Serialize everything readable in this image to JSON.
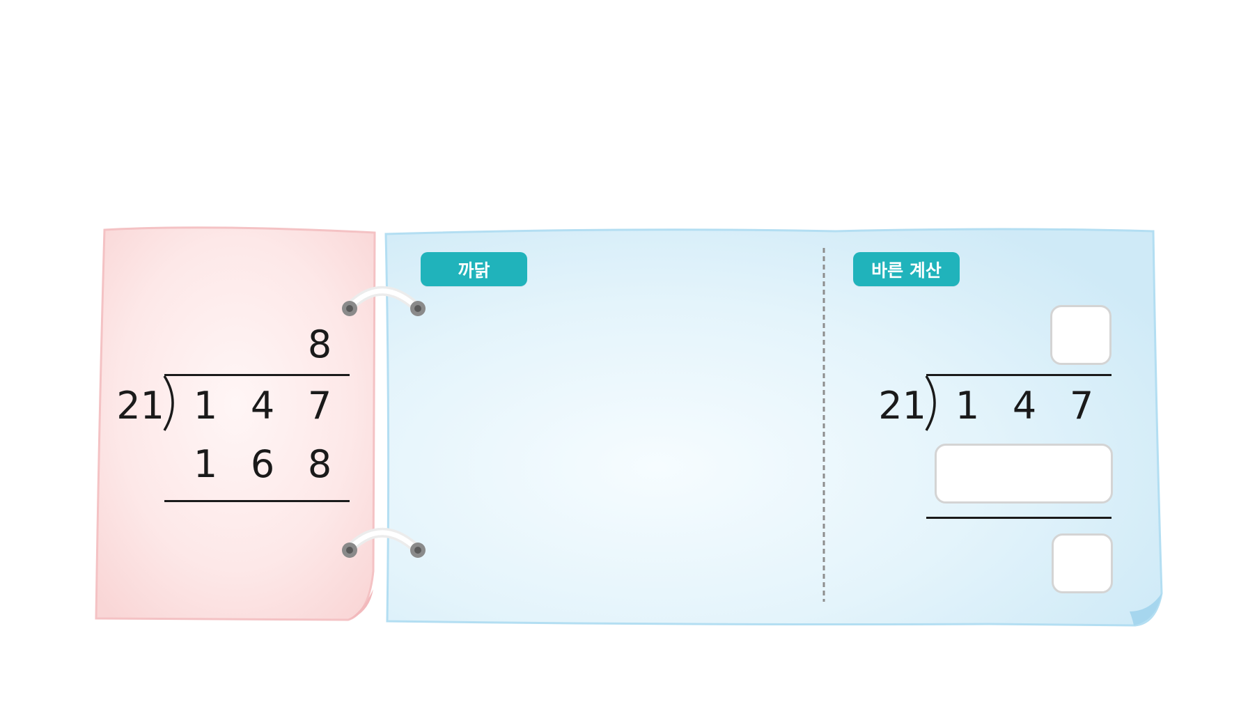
{
  "wrong_calculation": {
    "divisor": "21",
    "quotient": "8",
    "dividend_digits": [
      "1",
      "4",
      "7"
    ],
    "product_digits": [
      "1",
      "6",
      "8"
    ]
  },
  "reason_panel": {
    "tag_label": "까닭"
  },
  "correct_panel": {
    "tag_label": "바른 계산",
    "divisor": "21",
    "dividend_digits": [
      "1",
      "4",
      "7"
    ]
  },
  "colors": {
    "pink_sheet": "#fbe3e3",
    "blue_sheet": "#def1fa",
    "tag": "#20b3bb"
  }
}
